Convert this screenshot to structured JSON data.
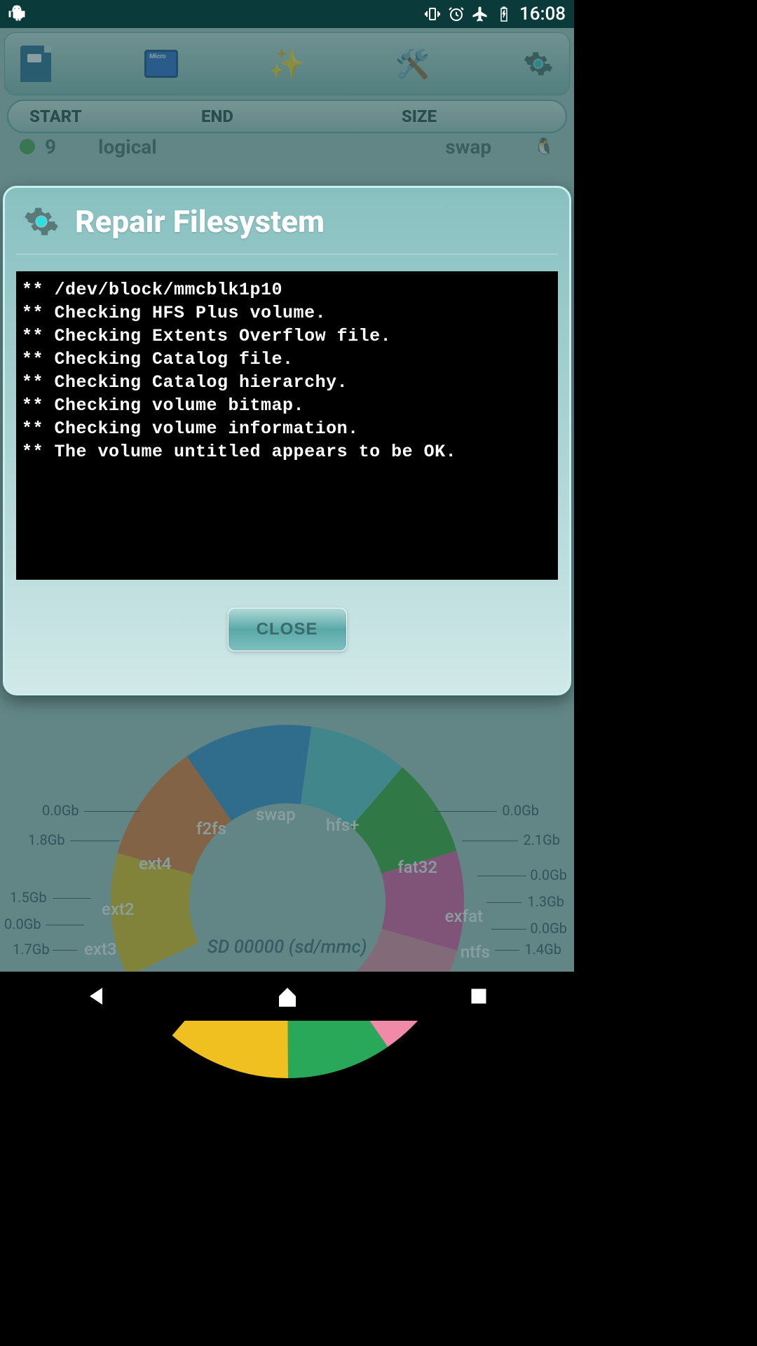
{
  "status": {
    "time": "16:08"
  },
  "toolbar": {
    "columns": {
      "start": "START",
      "end": "END",
      "size": "SIZE"
    }
  },
  "row_peek": {
    "index": "9",
    "type": "logical",
    "fs": "swap"
  },
  "dialog": {
    "title": "Repair Filesystem",
    "close_label": "CLOSE",
    "terminal_lines": [
      "** /dev/block/mmcblk1p10",
      "** Checking HFS Plus volume.",
      "** Checking Extents Overflow file.",
      "** Checking Catalog file.",
      "** Checking Catalog hierarchy.",
      "** Checking volume bitmap.",
      "** Checking volume information.",
      "** The volume untitled appears to be OK."
    ]
  },
  "chart": {
    "center": "SD 00000 (sd/mmc)",
    "segments": [
      {
        "name": "ext3",
        "size": "1.7Gb",
        "color": "#f0c020"
      },
      {
        "name": "ext2",
        "size": "1.5Gb",
        "color": "#f07a3a",
        "extra_size": "0.0Gb"
      },
      {
        "name": "ext4",
        "size": "1.8Gb",
        "color": "#3a90d8",
        "extra_size": "0.0Gb"
      },
      {
        "name": "f2fs",
        "size": "",
        "color": "#60c8d0"
      },
      {
        "name": "swap",
        "size": "",
        "color": "#3aa83a"
      },
      {
        "name": "hfs+",
        "size": "0.0Gb",
        "color": "#e85aa8"
      },
      {
        "name": "fat32",
        "size": "2.1Gb",
        "color": "#f08aa8",
        "extra_size": "0.0Gb"
      },
      {
        "name": "exfat",
        "size": "1.3Gb",
        "color": "#2aa85a",
        "extra_size": "0.0Gb"
      },
      {
        "name": "ntfs",
        "size": "1.4Gb",
        "color": "#f0c020"
      }
    ]
  },
  "chart_data": {
    "type": "pie",
    "title": "SD 00000 (sd/mmc)",
    "series": [
      {
        "name": "ext3",
        "value": 1.7,
        "unit": "Gb",
        "color": "#f0c020"
      },
      {
        "name": "ext2",
        "value": 1.5,
        "unit": "Gb",
        "color": "#f07a3a"
      },
      {
        "name": "ext4",
        "value": 1.8,
        "unit": "Gb",
        "color": "#3a90d8"
      },
      {
        "name": "f2fs",
        "value": null,
        "unit": "Gb",
        "color": "#60c8d0"
      },
      {
        "name": "swap",
        "value": null,
        "unit": "Gb",
        "color": "#3aa83a"
      },
      {
        "name": "hfs+",
        "value": 0.0,
        "unit": "Gb",
        "color": "#e85aa8"
      },
      {
        "name": "fat32",
        "value": 2.1,
        "unit": "Gb",
        "color": "#f08aa8"
      },
      {
        "name": "exfat",
        "value": 1.3,
        "unit": "Gb",
        "color": "#2aa85a"
      },
      {
        "name": "ntfs",
        "value": 1.4,
        "unit": "Gb",
        "color": "#f0c020"
      }
    ],
    "extra_labels": [
      "0.0Gb",
      "0.0Gb",
      "0.0Gb",
      "0.0Gb"
    ]
  }
}
